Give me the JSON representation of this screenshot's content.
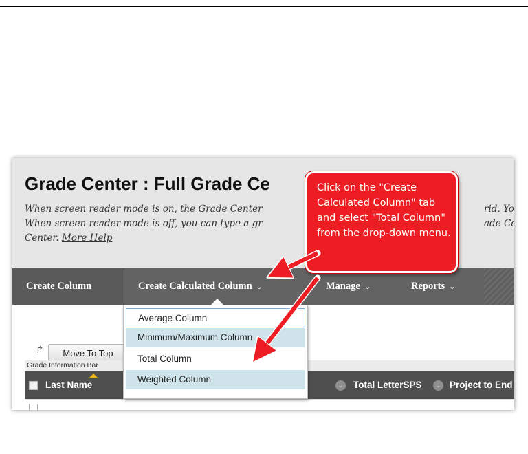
{
  "page": {
    "title": "Grade Center : Full Grade Ce",
    "description_lines": [
      "When screen reader mode is on, the Grade Center",
      "When screen reader mode is off, you can type a gr",
      "Center."
    ],
    "description_line1_tail": "rid. You ca",
    "description_line2_tail": "ade Center",
    "more_help": "More Help"
  },
  "nav": {
    "create_column": "Create Column",
    "create_calculated_column": "Create Calculated Column",
    "manage": "Manage",
    "reports": "Reports",
    "chevron": "⌄"
  },
  "dropdown": {
    "items": [
      "Average Column",
      "Minimum/Maximum Column",
      "Total Column",
      "Weighted Column"
    ]
  },
  "toolbar": {
    "move_to_top": "Move To Top",
    "grade_info_bar": "Grade Information Bar"
  },
  "table": {
    "headers": {
      "last_name": "Last Name",
      "total_letter": "Total LetterSPS",
      "project": "Project to End V"
    }
  },
  "callout": {
    "text": "Click on the \"Create Calculated Column\" tab and select \"Total Column\" from the drop-down menu."
  },
  "colors": {
    "callout_red": "#ec1e24",
    "nav_gray": "#636363",
    "header_gray": "#e6e6e6",
    "dropdown_highlight": "#cfe3ea"
  },
  "icons": {
    "nav_chevron": "chevron-down-icon",
    "row_move": "move-arrow-icon",
    "header_menu": "column-menu-icon",
    "sort": "sort-ascending-icon"
  }
}
